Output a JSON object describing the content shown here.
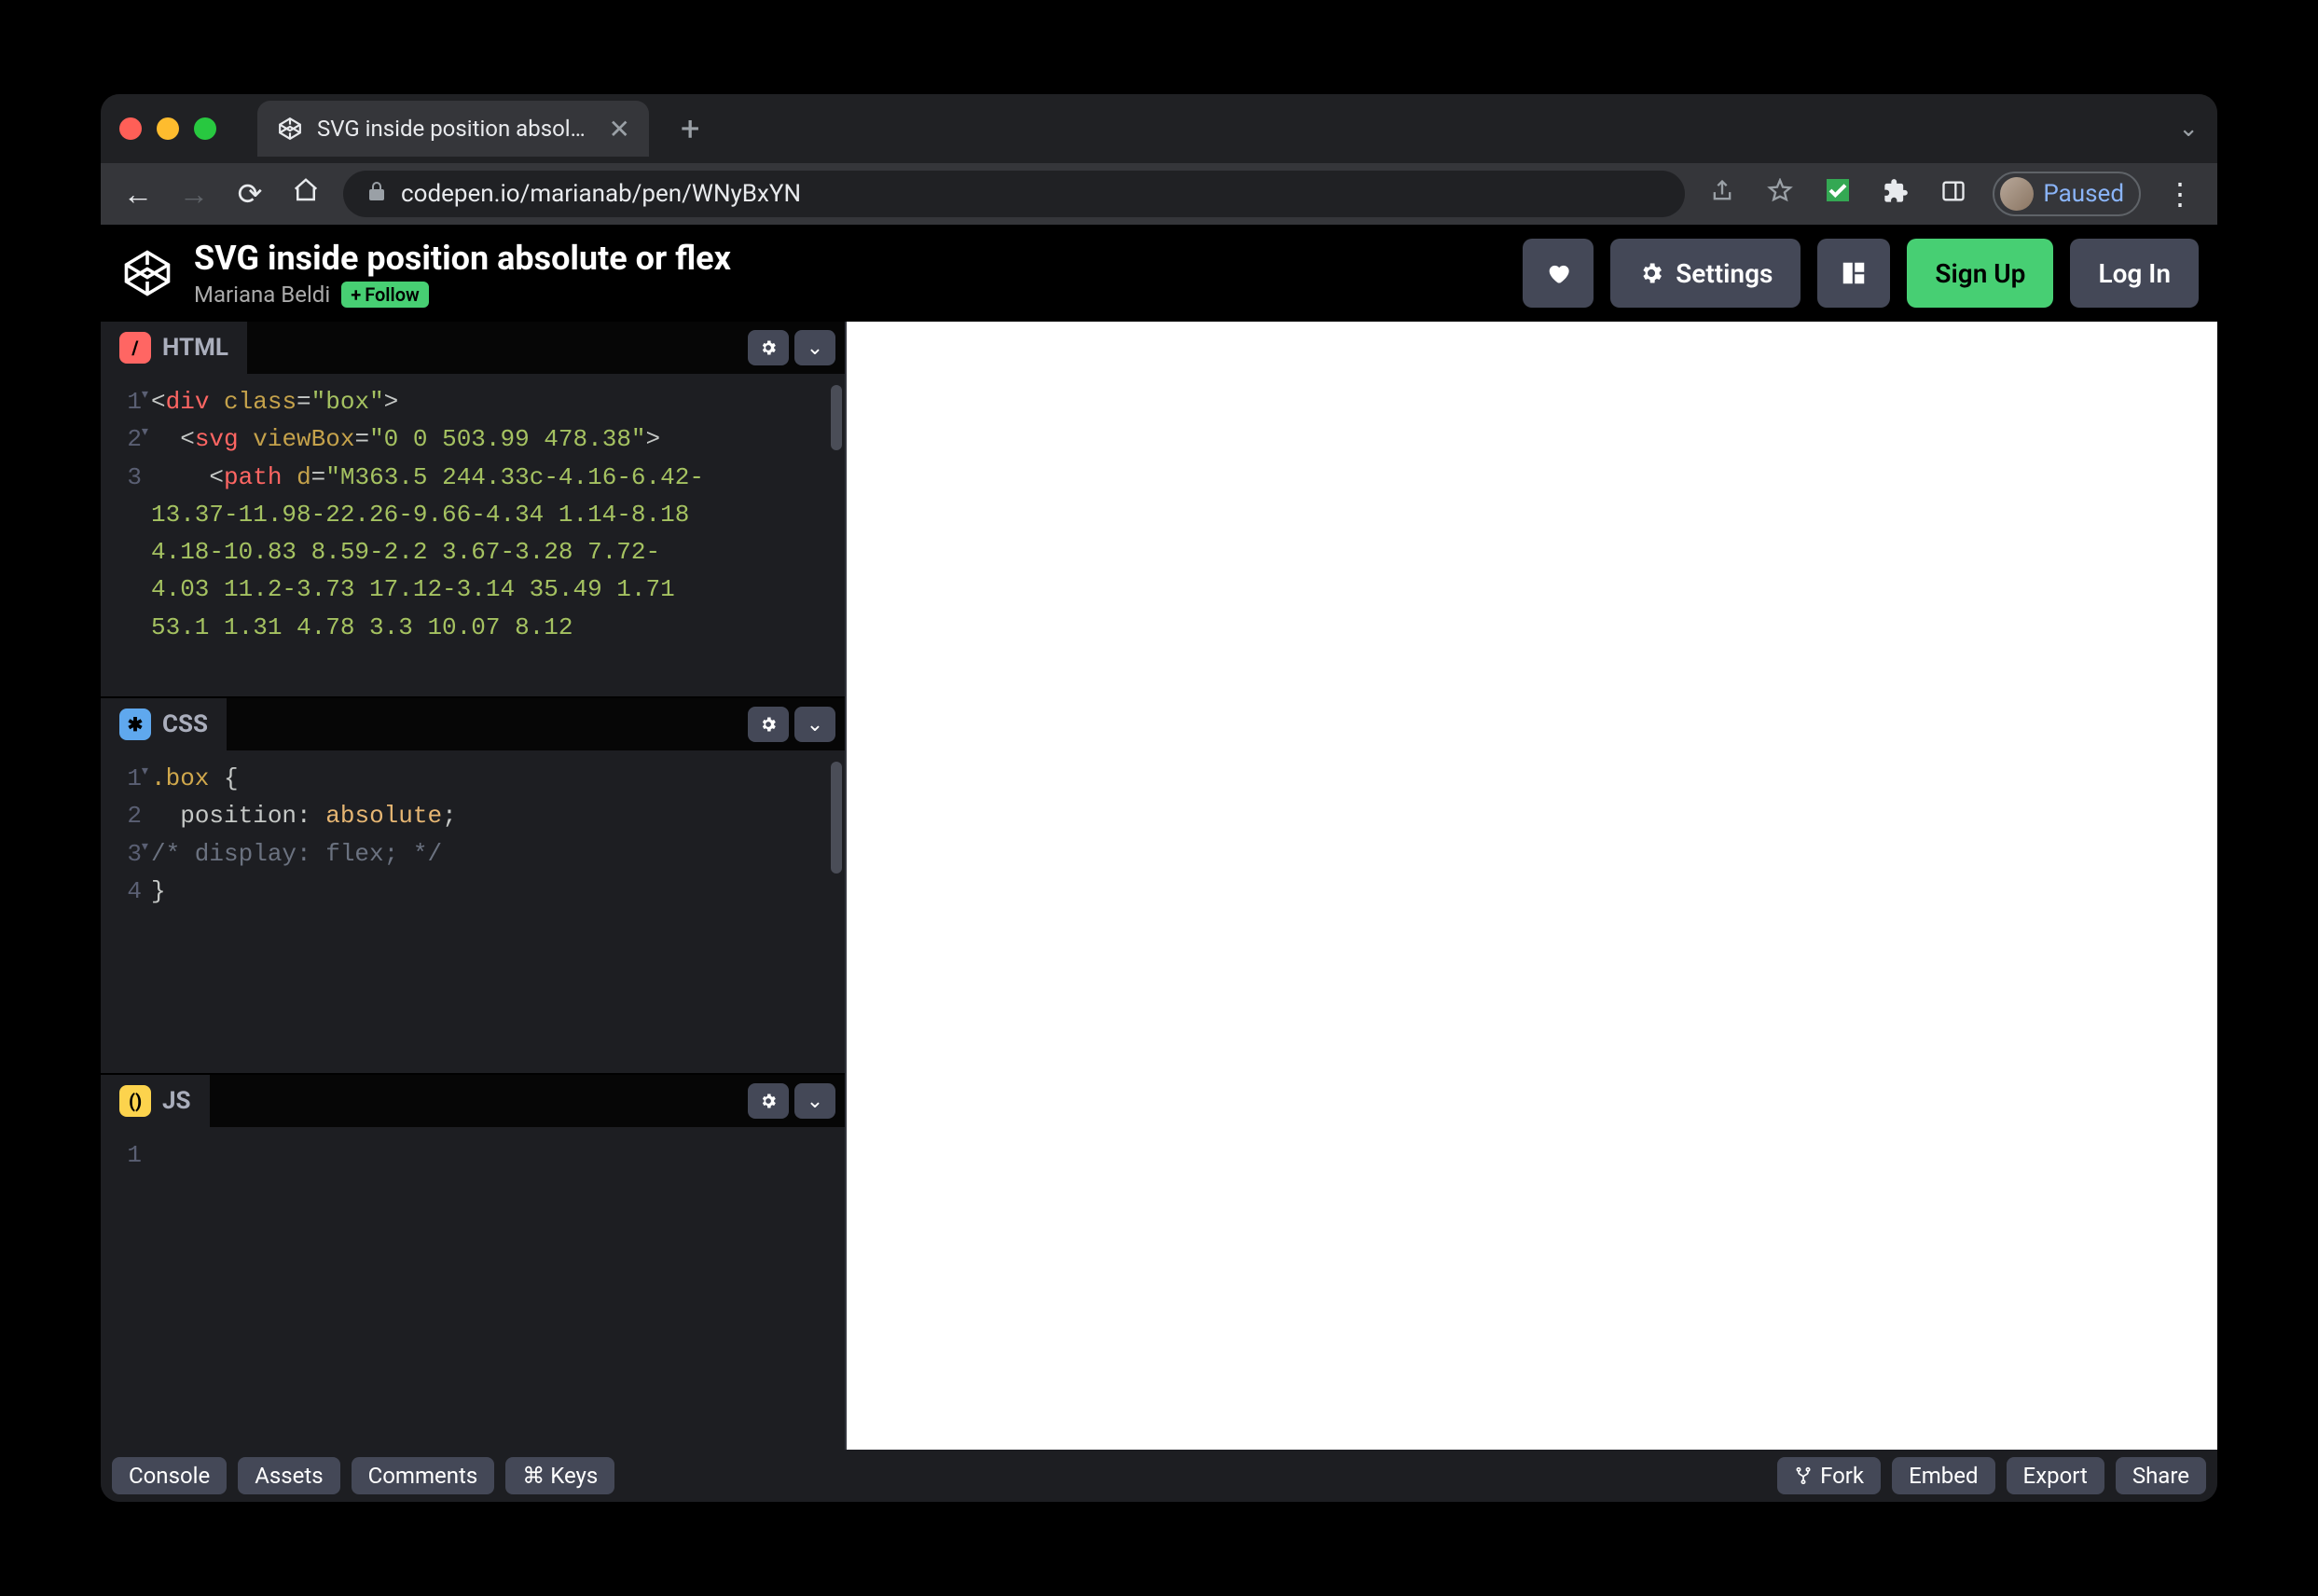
{
  "browser": {
    "tab_title": "SVG inside position absolute o…",
    "url": "codepen.io/marianab/pen/WNyBxYN",
    "paused_label": "Paused"
  },
  "header": {
    "title": "SVG inside position absolute or flex",
    "author": "Mariana Beldi",
    "follow_label": "Follow",
    "settings_label": "Settings",
    "signup_label": "Sign Up",
    "login_label": "Log In"
  },
  "panels": {
    "html": {
      "label": "HTML",
      "lines": [
        "1",
        "2",
        "3",
        "",
        "",
        "",
        "",
        ""
      ],
      "code": "<div class=\"box\">\n  <svg viewBox=\"0 0 503.99 478.38\">\n    <path d=\"M363.5 244.33c-4.16-6.42-\n13.37-11.98-22.26-9.66-4.34 1.14-8.18\n4.18-10.83 8.59-2.2 3.67-3.28 7.72-\n4.03 11.2-3.73 17.12-3.14 35.49 1.71\n53.1 1.31 4.78 3.3 10.07 8.12"
    },
    "css": {
      "label": "CSS",
      "lines": [
        "1",
        "2",
        "3",
        "4"
      ],
      "code_lines": [
        {
          "t": "sel",
          "v": ".box {"
        },
        {
          "t": "decl",
          "p": "position",
          "v": "absolute"
        },
        {
          "t": "comment",
          "v": "/* display: flex; */"
        },
        {
          "t": "close",
          "v": "}"
        }
      ]
    },
    "js": {
      "label": "JS",
      "lines": [
        "1"
      ],
      "code": ""
    }
  },
  "footer": {
    "left": [
      "Console",
      "Assets",
      "Comments",
      "⌘ Keys"
    ],
    "right": [
      "Fork",
      "Embed",
      "Export",
      "Share"
    ]
  }
}
